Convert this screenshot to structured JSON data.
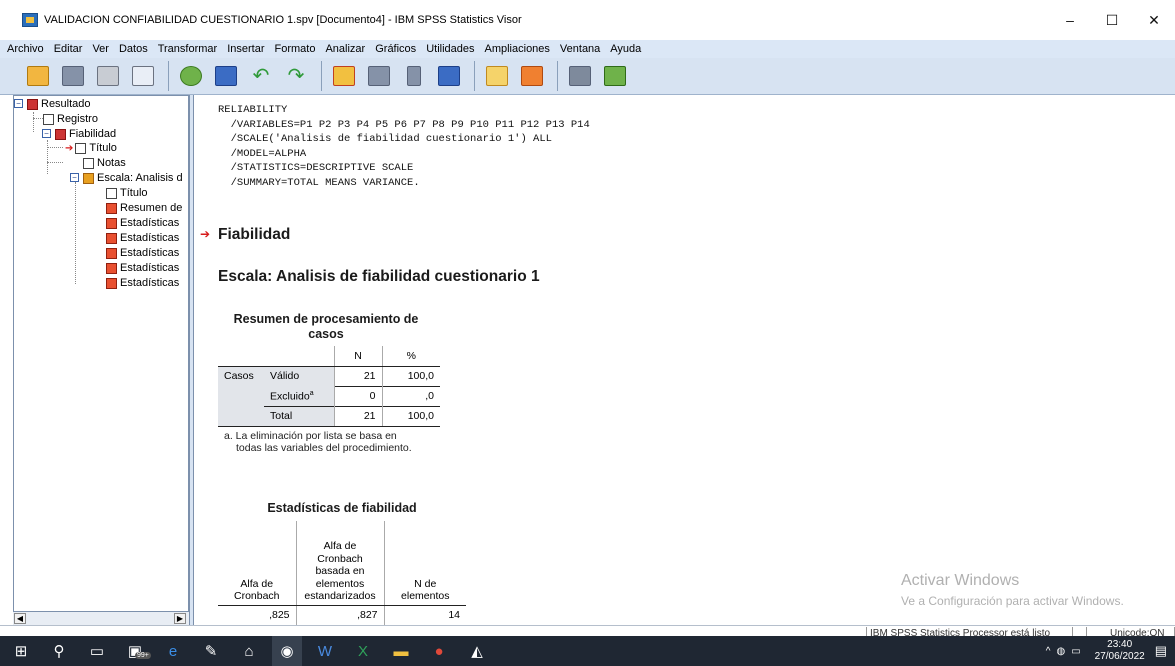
{
  "window": {
    "title": "VALIDACION CONFIABILIDAD CUESTIONARIO 1.spv [Documento4] - IBM SPSS Statistics Visor",
    "minimize": "–",
    "maximize": "☐",
    "close": "✕"
  },
  "menu": [
    "Archivo",
    "Editar",
    "Ver",
    "Datos",
    "Transformar",
    "Insertar",
    "Formato",
    "Analizar",
    "Gráficos",
    "Utilidades",
    "Ampliaciones",
    "Ventana",
    "Ayuda"
  ],
  "toolbar": {
    "icons": [
      "open-folder-icon",
      "save-icon",
      "print-icon",
      "print-preview-icon",
      "export-icon",
      "recall-dialog-icon",
      "undo-icon",
      "redo-icon",
      "goto-case-icon",
      "goto-variable-icon",
      "insert-icon",
      "variables-icon",
      "designate-window-icon",
      "insert-output-icon",
      "hide-icon",
      "show-icon"
    ]
  },
  "outline": {
    "root": "Resultado",
    "log": "Registro",
    "reliability": "Fiabilidad",
    "title": "Título",
    "notes": "Notas",
    "scale": "Escala: Analisis d",
    "scale_title": "Título",
    "summary": "Resumen de",
    "stats1": "Estadísticas",
    "stats2": "Estadísticas",
    "stats3": "Estadísticas",
    "stats4": "Estadísticas",
    "stats5": "Estadísticas"
  },
  "syntax": "RELIABILITY\n  /VARIABLES=P1 P2 P3 P4 P5 P6 P7 P8 P9 P10 P11 P12 P13 P14\n  /SCALE('Analisis de fiabilidad cuestionario 1') ALL\n  /MODEL=ALPHA\n  /STATISTICS=DESCRIPTIVE SCALE\n  /SUMMARY=TOTAL MEANS VARIANCE.",
  "output": {
    "heading": "Fiabilidad",
    "scale_heading": "Escala: Analisis de fiabilidad cuestionario 1"
  },
  "case_summary": {
    "title": "Resumen de procesamiento de casos",
    "col_n": "N",
    "col_pct": "%",
    "row_group": "Casos",
    "rows": [
      {
        "label": "Válido",
        "n": "21",
        "pct": "100,0"
      },
      {
        "label": "Excluido",
        "sup": "a",
        "n": "0",
        "pct": ",0"
      },
      {
        "label": "Total",
        "n": "21",
        "pct": "100,0"
      }
    ],
    "footnote": "a. La eliminación por lista se basa en todas las variables del procedimiento."
  },
  "reliability_stats": {
    "title": "Estadísticas de fiabilidad",
    "col_alpha": "Alfa de Cronbach",
    "col_alpha_std": "Alfa de Cronbach basada en elementos estandarizados",
    "col_n": "N de elementos",
    "alpha": ",825",
    "alpha_std": ",827",
    "n_items": "14"
  },
  "watermark": {
    "line1": "Activar Windows",
    "line2": "Ve a Configuración para activar Windows."
  },
  "status": {
    "processor": "IBM SPSS Statistics Processor está listo",
    "unicode": "Unicode:ON"
  },
  "taskbar": {
    "badge": "99+",
    "time": "23:40",
    "date": "27/06/2022"
  }
}
